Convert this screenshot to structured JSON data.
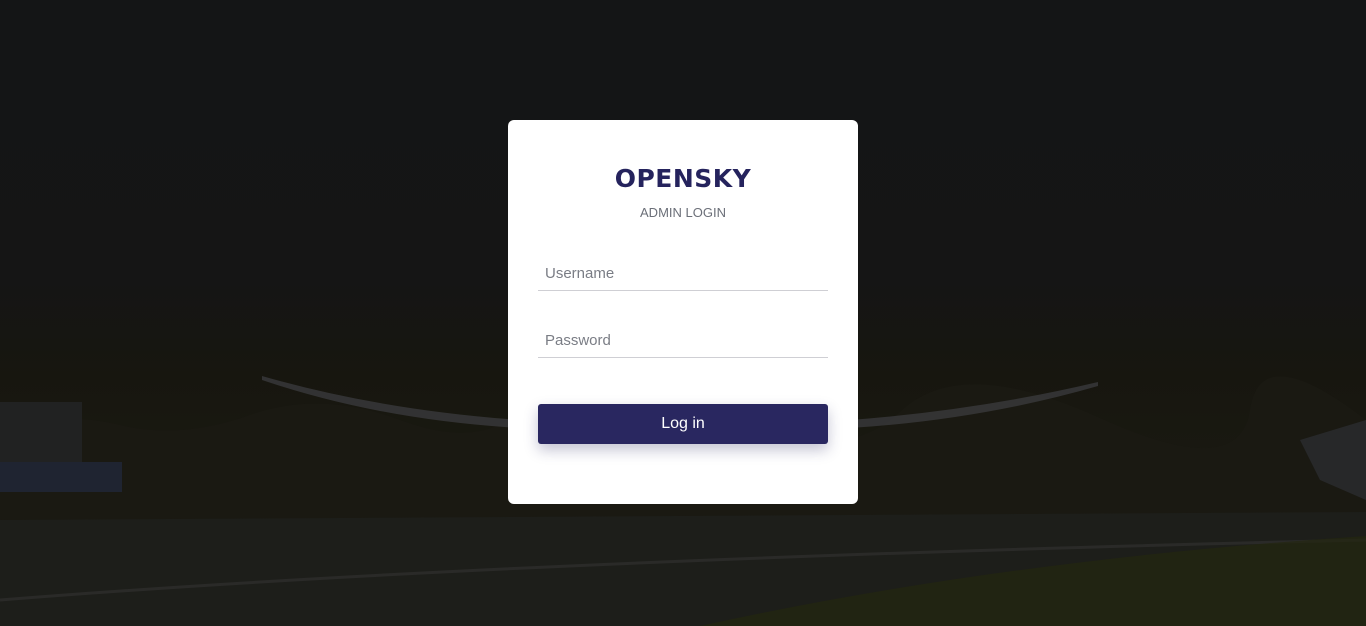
{
  "login": {
    "brand": "OPENSKY",
    "subtitle": "ADMIN LOGIN",
    "username_placeholder": "Username",
    "password_placeholder": "Password",
    "submit_label": "Log in"
  },
  "colors": {
    "brand": "#25235d",
    "button": "#292760",
    "card": "#ffffff",
    "background": "#161616"
  }
}
